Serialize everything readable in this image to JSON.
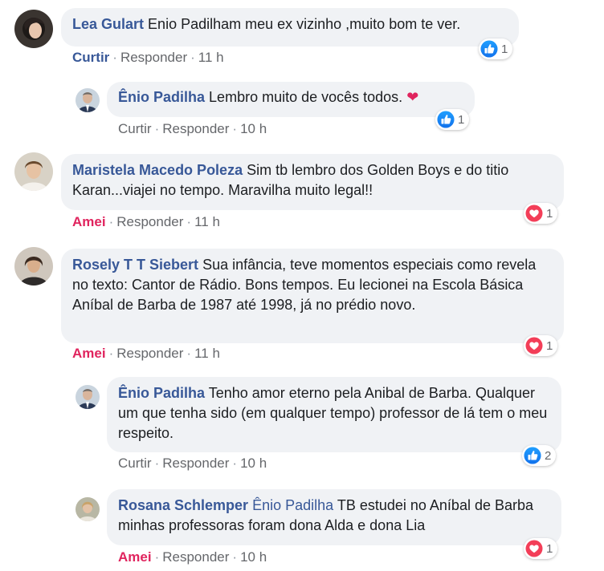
{
  "comments": [
    {
      "author": "Lea Gulart",
      "text": "Enio Padilham meu ex vizinho ,muito bom te ver.",
      "action": "Curtir",
      "reply": "Responder",
      "time": "11 h",
      "reaction": {
        "type": "like-icon",
        "count": "1"
      }
    },
    {
      "author": "Ênio Padilha",
      "text": "Lembro muito de vocês todos.",
      "action": "Curtir",
      "reply": "Responder",
      "time": "10 h",
      "reaction": {
        "type": "like-icon",
        "count": "1"
      }
    },
    {
      "author": "Maristela Macedo Poleza",
      "text": "Sim tb lembro dos Golden Boys e do titio Karan...viajei no tempo. Maravilha muito legal!!",
      "action": "Amei",
      "reply": "Responder",
      "time": "11 h",
      "reaction": {
        "type": "love-icon",
        "count": "1"
      }
    },
    {
      "author": "Rosely T T Siebert",
      "text": "Sua infância, teve momentos especiais como revela no texto: Cantor de Rádio. Bons tempos. Eu lecionei na Escola Básica Aníbal de Barba de 1987 até 1998, já no prédio novo.",
      "action": "Amei",
      "reply": "Responder",
      "time": "11 h",
      "reaction": {
        "type": "love-icon",
        "count": "1"
      }
    },
    {
      "author": "Ênio Padilha",
      "text": "Tenho amor eterno pela Anibal de Barba. Qualquer um que tenha sido (em qualquer tempo) professor de lá tem o meu respeito.",
      "action": "Curtir",
      "reply": "Responder",
      "time": "10 h",
      "reaction": {
        "type": "like-icon",
        "count": "2"
      }
    },
    {
      "author": "Rosana Schlemper",
      "mention": "Ênio Padilha",
      "text": "TB estudei no Aníbal de Barba minhas professoras foram dona Alda e dona Lia",
      "action": "Amei",
      "reply": "Responder",
      "time": "10 h",
      "reaction": {
        "type": "love-icon",
        "count": "1"
      }
    }
  ],
  "separator": "·",
  "colors": {
    "link": "#385898",
    "love": "#e0245e",
    "like": "#1877f2",
    "bubble": "#f0f2f5"
  }
}
